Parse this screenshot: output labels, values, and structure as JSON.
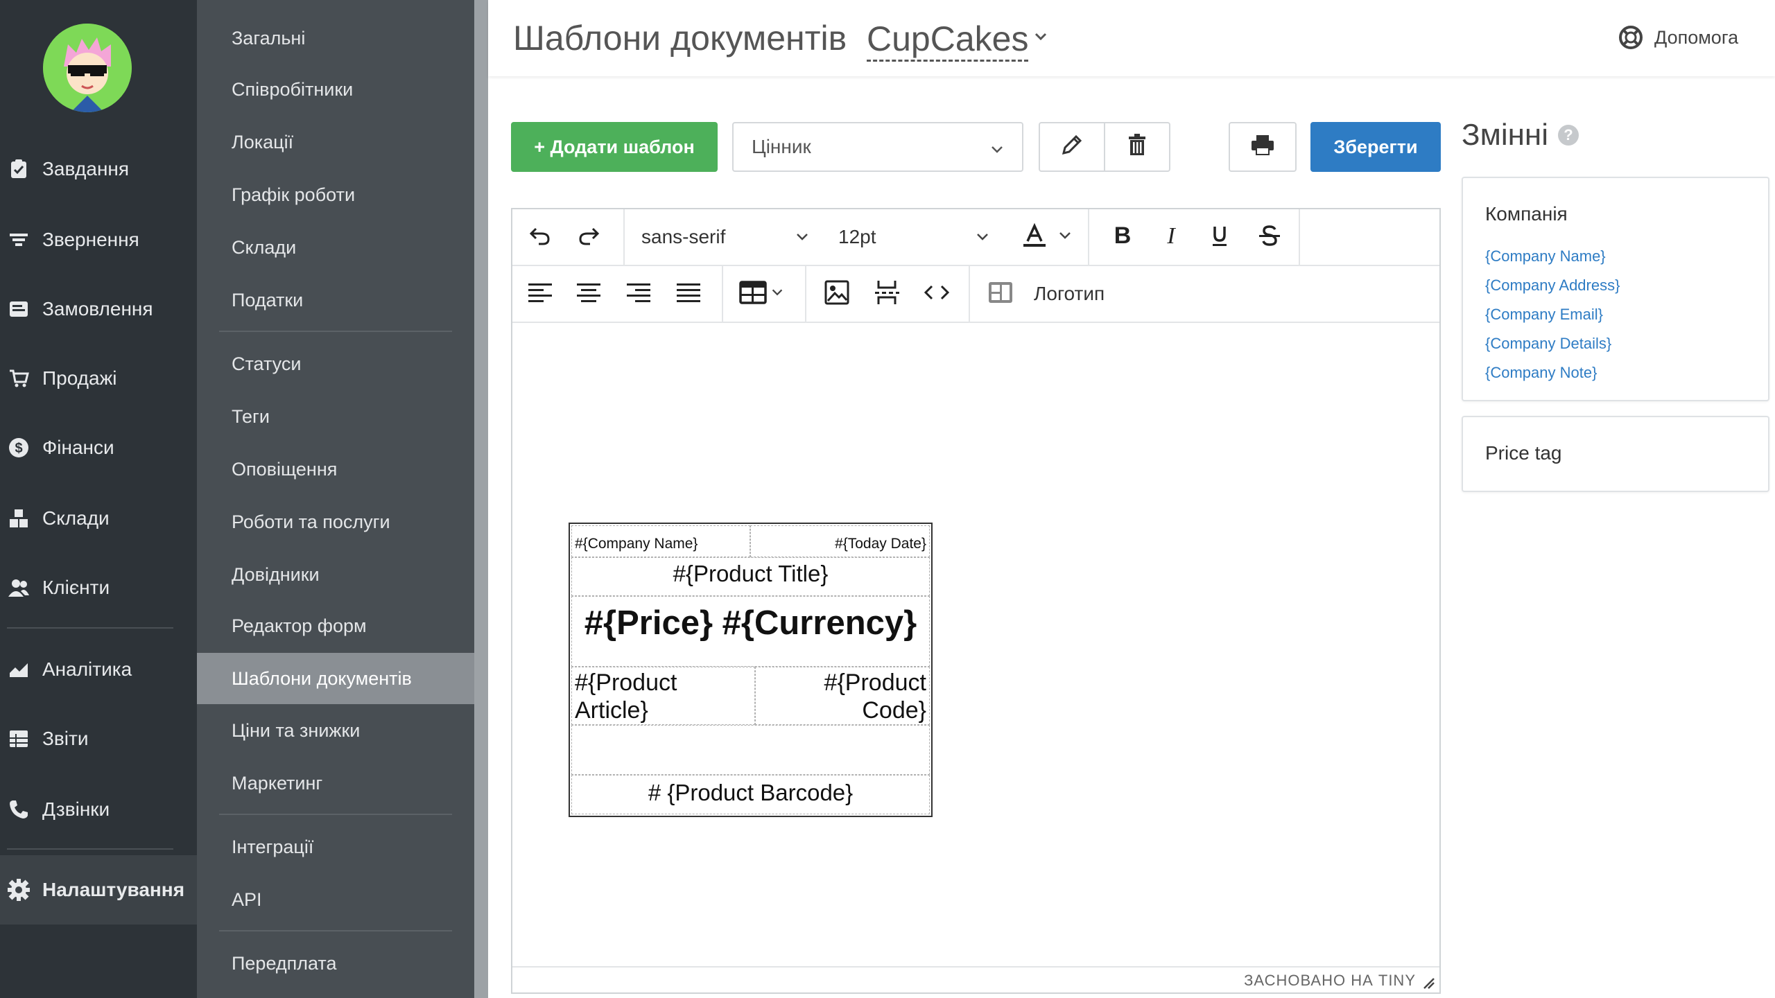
{
  "nav_main": {
    "items": [
      {
        "label": "Завдання",
        "icon": "clipboard-icon"
      },
      {
        "label": "Звернення",
        "icon": "filter-icon"
      },
      {
        "label": "Замовлення",
        "icon": "orders-icon"
      },
      {
        "label": "Продажі",
        "icon": "cart-icon"
      },
      {
        "label": "Фінанси",
        "icon": "dollar-icon"
      },
      {
        "label": "Склади",
        "icon": "boxes-icon"
      },
      {
        "label": "Клієнти",
        "icon": "users-icon"
      },
      {
        "label": "Аналітика",
        "icon": "chart-icon"
      },
      {
        "label": "Звіти",
        "icon": "table-icon"
      },
      {
        "label": "Дзвінки",
        "icon": "phone-icon"
      },
      {
        "label": "Налаштування",
        "icon": "gear-icon"
      }
    ],
    "active": "Налаштування"
  },
  "nav_settings": {
    "items": [
      "Загальні",
      "Співробітники",
      "Локації",
      "Графік роботи",
      "Склади",
      "Податки",
      "Статуси",
      "Теги",
      "Оповіщення",
      "Роботи та послуги",
      "Довідники",
      "Редактор форм",
      "Шаблони документів",
      "Ціни та знижки",
      "Маркетинг",
      "Інтеграції",
      "API",
      "Передплата"
    ],
    "active": "Шаблони документів"
  },
  "header": {
    "title": "Шаблони документів",
    "company": "CupCakes",
    "help_label": "Допомога"
  },
  "toolbar": {
    "add_label": "+ Додати шаблон",
    "template_selected": "Цінник",
    "save_label": "Зберегти"
  },
  "editor": {
    "font_family": "sans-serif",
    "font_size": "12pt",
    "logo_label": "Логотип",
    "powered_by": "ЗАСНОВАНО НА TINY"
  },
  "price_tag": {
    "company_name": "#{Company Name}",
    "today_date": "#{Today Date}",
    "product_title": "#{Product Title}",
    "price_currency": "#{Price} #{Currency}",
    "product_article_1": "#{Product",
    "product_article_2": "Article}",
    "product_code_1": "#{Product",
    "product_code_2": "Code}",
    "product_barcode": "# {Product Barcode}"
  },
  "variables": {
    "title": "Змінні",
    "help_mark": "?",
    "company_group": "Компанія",
    "company_vars": [
      "{Company Name}",
      "{Company Address}",
      "{Company Email}",
      "{Company Details}",
      "{Company Note}"
    ],
    "price_group": "Price tag"
  }
}
